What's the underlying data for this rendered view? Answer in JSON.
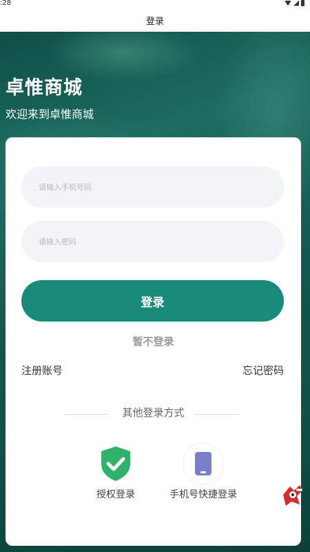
{
  "status_bar": {
    "time": ":28"
  },
  "header": {
    "title": "登录"
  },
  "brand": {
    "title": "卓惟商城",
    "subtitle": "欢迎来到卓惟商城"
  },
  "form": {
    "phone_placeholder": "请输入手机号码",
    "password_placeholder": "请输入密码",
    "login_label": "登录",
    "skip_label": "暂不登录",
    "register_label": "注册账号",
    "forgot_label": "忘记密码"
  },
  "other_login": {
    "divider_label": "其他登录方式",
    "options": [
      {
        "label": "授权登录",
        "icon": "shield-check-icon",
        "color": "#2fb36b"
      },
      {
        "label": "手机号快捷登录",
        "icon": "mobile-phone-icon",
        "color": "#7a80c7"
      }
    ]
  },
  "colors": {
    "accent": "#1a8b7b",
    "input_bg": "#f3f4f8",
    "hero_bg": "#145a50"
  }
}
